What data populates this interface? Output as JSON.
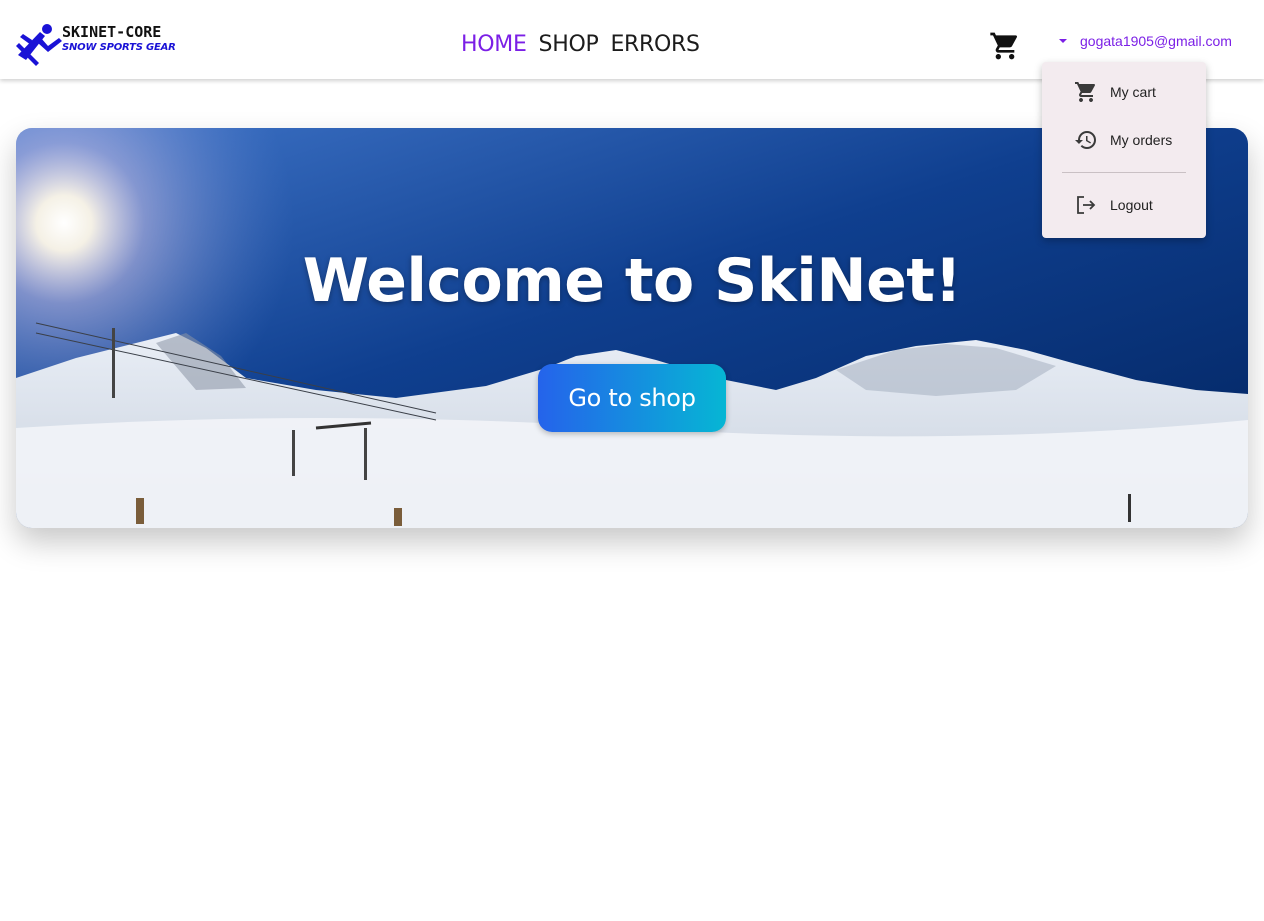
{
  "header": {
    "logo": {
      "line1": "SKINET-CORE",
      "line2": "SNOW SPORTS GEAR"
    },
    "nav": [
      {
        "label": "HOME",
        "active": true
      },
      {
        "label": "SHOP",
        "active": false
      },
      {
        "label": "ERRORS",
        "active": false
      }
    ],
    "cart_icon": "shopping-cart-icon",
    "user": {
      "email": "gogata1905@gmail.com",
      "caret_icon": "caret-down-icon"
    }
  },
  "user_menu": {
    "items": [
      {
        "label": "My cart",
        "icon": "shopping-cart-icon"
      },
      {
        "label": "My orders",
        "icon": "history-icon"
      },
      {
        "label": "Logout",
        "icon": "logout-icon"
      }
    ]
  },
  "hero": {
    "title": "Welcome to SkiNet!",
    "button_label": "Go to shop"
  },
  "colors": {
    "accent": "#7b1fe6",
    "menu_bg": "#f3ebef",
    "button_gradient_start": "#2563eb",
    "button_gradient_end": "#06b6d4",
    "logo_blue": "#1a12d6"
  }
}
